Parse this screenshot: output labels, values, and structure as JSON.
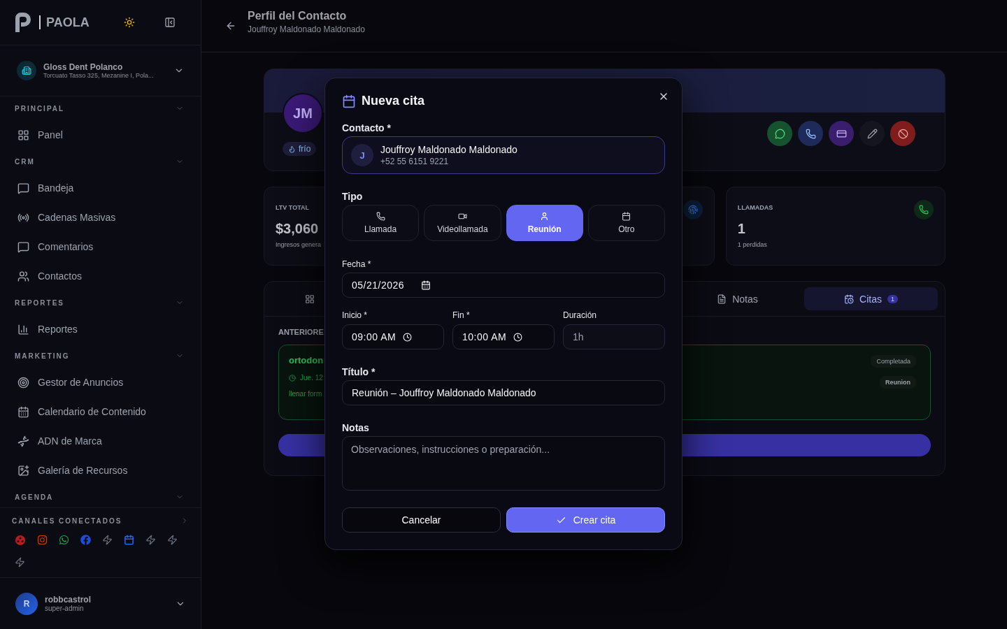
{
  "sidebar": {
    "brand": "PAOLA",
    "org": {
      "name": "Gloss Dent Polanco",
      "address": "Torcuato Tasso 325, Mezanine I, Pola..."
    },
    "sections": [
      {
        "title": "PRINCIPAL",
        "items": [
          "Panel"
        ]
      },
      {
        "title": "CRM",
        "items": [
          "Bandeja",
          "Cadenas Masivas",
          "Comentarios",
          "Contactos"
        ]
      },
      {
        "title": "REPORTES",
        "items": [
          "Reportes"
        ]
      },
      {
        "title": "MARKETING",
        "items": [
          "Gestor de Anuncios",
          "Calendario de Contenido",
          "ADN de Marca",
          "Galería de Recursos"
        ]
      },
      {
        "title": "AGENDA"
      }
    ],
    "channels_title": "CANALES CONECTADOS",
    "channels": [
      {
        "kind": "dots",
        "color": "#b91c1c"
      },
      {
        "kind": "instagram",
        "color": "#c2410c"
      },
      {
        "kind": "whatsapp",
        "color": "#16a34a"
      },
      {
        "kind": "facebook",
        "color": "#1d4ed8"
      },
      {
        "kind": "bolt",
        "color": "#6b7280"
      },
      {
        "kind": "calendar",
        "color": "#2563eb"
      },
      {
        "kind": "bolt",
        "color": "#6b7280"
      },
      {
        "kind": "bolt",
        "color": "#6b7280"
      },
      {
        "kind": "bolt",
        "color": "#6b7280"
      }
    ],
    "user": {
      "initial": "R",
      "name": "robbcastrol",
      "role": "super-admin"
    }
  },
  "header": {
    "title": "Perfil del Contacto",
    "subtitle": "Jouffroy Maldonado Maldonado"
  },
  "profile": {
    "initials": "JM",
    "tag": "frío"
  },
  "stats": [
    {
      "label": "LTV TOTAL",
      "value": "$3,060",
      "note": "Ingresos genera"
    },
    {
      "label": "LLAMADAS",
      "value": "1",
      "note": "1 perdidas"
    }
  ],
  "tabs": [
    {
      "selected": false
    },
    {
      "label": "Notas",
      "selected": false
    },
    {
      "label": "Citas",
      "selected": true,
      "count": "1"
    }
  ],
  "history": {
    "heading": "ANTERIORE",
    "item": {
      "title": "ortodon",
      "date": "Jue. 12",
      "note": "llenar form",
      "status": "Completada",
      "type": "Reunion"
    }
  },
  "modal": {
    "title": "Nueva cita",
    "contact_label": "Contacto *",
    "contact": {
      "initial": "J",
      "name": "Jouffroy Maldonado Maldonado",
      "phone": "+52 55 6151 9221"
    },
    "type_label": "Tipo",
    "types": [
      {
        "kind": "call",
        "label": "Llamada",
        "selected": false
      },
      {
        "kind": "video",
        "label": "Videollamada",
        "selected": false
      },
      {
        "kind": "meeting",
        "label": "Reunión",
        "selected": true
      },
      {
        "kind": "other",
        "label": "Otro",
        "selected": false
      }
    ],
    "date_label": "Fecha *",
    "date": "05/21/2026",
    "start_label": "Inicio *",
    "start": "09:00 AM",
    "end_label": "Fin *",
    "end": "10:00 AM",
    "duration_label": "Duración",
    "duration": "1h",
    "title_label": "Título *",
    "title_value": "Reunión – Jouffroy Maldonado Maldonado",
    "notes_label": "Notas",
    "notes_placeholder": "Observaciones, instrucciones o preparación...",
    "cancel": "Cancelar",
    "submit": "Crear cita"
  }
}
